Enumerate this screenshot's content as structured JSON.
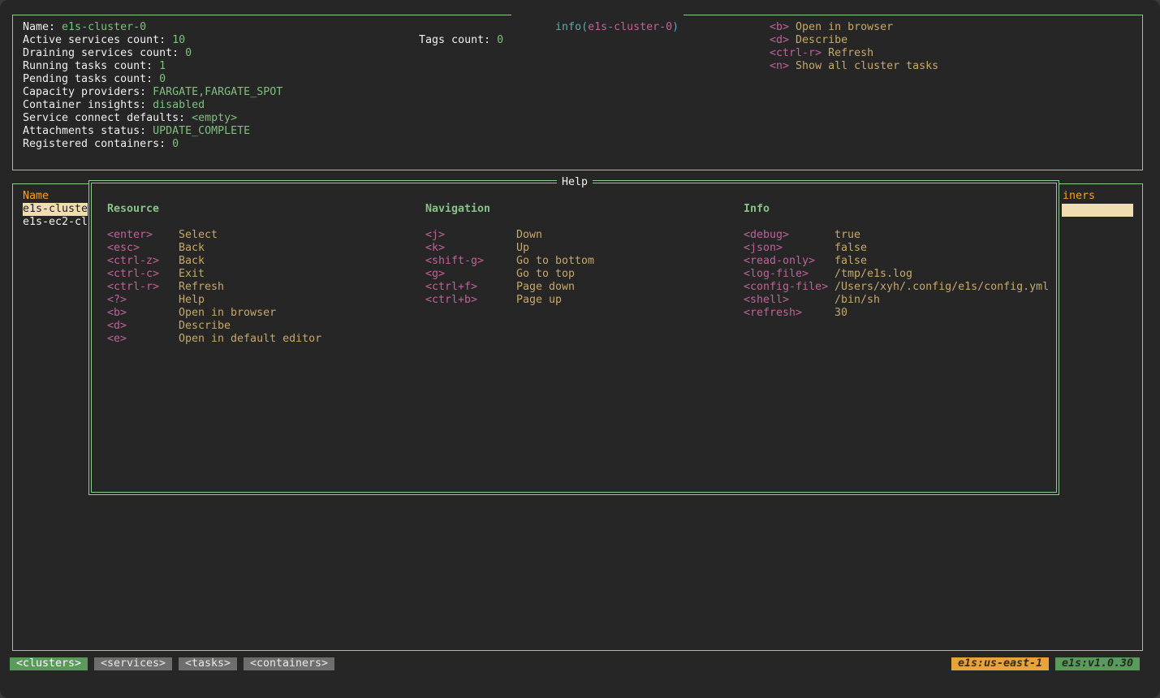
{
  "info_panel": {
    "title_prefix": "info(",
    "title_name": "e1s-cluster-0",
    "title_suffix": ")",
    "fields": [
      {
        "label": "Name: ",
        "value": "e1s-cluster-0"
      },
      {
        "label": "Active services count: ",
        "value": "10"
      },
      {
        "label": "Draining services count: ",
        "value": "0"
      },
      {
        "label": "Running tasks count: ",
        "value": "1"
      },
      {
        "label": "Pending tasks count: ",
        "value": "0"
      },
      {
        "label": "Capacity providers: ",
        "value": "FARGATE,FARGATE_SPOT"
      },
      {
        "label": "Container insights: ",
        "value": "disabled"
      },
      {
        "label": "Service connect defaults: ",
        "value": "<empty>"
      },
      {
        "label": "Attachments status: ",
        "value": "UPDATE_COMPLETE"
      },
      {
        "label": "Registered containers: ",
        "value": "0"
      }
    ],
    "tags": {
      "label": "Tags count: ",
      "value": "0"
    },
    "shortcuts": [
      {
        "key": "<b>",
        "desc": "Open in browser"
      },
      {
        "key": "<d>",
        "desc": "Describe"
      },
      {
        "key": "<ctrl-r>",
        "desc": "Refresh"
      },
      {
        "key": "<n>",
        "desc": "Show all cluster tasks"
      }
    ]
  },
  "list_panel": {
    "header_name": "Name",
    "header_right": "iners",
    "rows": [
      "e1s-cluste",
      "e1s-ec2-cl"
    ]
  },
  "help_modal": {
    "title": "Help",
    "sections": [
      {
        "title": "Resource",
        "items": [
          {
            "key": "<enter>",
            "desc": "Select"
          },
          {
            "key": "<esc>",
            "desc": "Back"
          },
          {
            "key": "<ctrl-z>",
            "desc": "Back"
          },
          {
            "key": "<ctrl-c>",
            "desc": "Exit"
          },
          {
            "key": "<ctrl-r>",
            "desc": "Refresh"
          },
          {
            "key": "<?>",
            "desc": "Help"
          },
          {
            "key": "<b>",
            "desc": "Open in browser"
          },
          {
            "key": "<d>",
            "desc": "Describe"
          },
          {
            "key": "<e>",
            "desc": "Open in default editor"
          }
        ]
      },
      {
        "title": "Navigation",
        "items": [
          {
            "key": "<j>",
            "desc": "Down"
          },
          {
            "key": "<k>",
            "desc": "Up"
          },
          {
            "key": "<shift-g>",
            "desc": "Go to bottom"
          },
          {
            "key": "<g>",
            "desc": "Go to top"
          },
          {
            "key": "<ctrl+f>",
            "desc": "Page down"
          },
          {
            "key": "<ctrl+b>",
            "desc": "Page up"
          }
        ]
      },
      {
        "title": "Info",
        "items": [
          {
            "key": "<debug>",
            "desc": "true"
          },
          {
            "key": "<json>",
            "desc": "false"
          },
          {
            "key": "<read-only>",
            "desc": "false"
          },
          {
            "key": "<log-file>",
            "desc": "/tmp/e1s.log"
          },
          {
            "key": "<config-file>",
            "desc": "/Users/xyh/.config/e1s/config.yml"
          },
          {
            "key": "<shell>",
            "desc": "/bin/sh"
          },
          {
            "key": "<refresh>",
            "desc": "30"
          }
        ]
      }
    ]
  },
  "tabs": [
    {
      "label": "<clusters>",
      "active": true
    },
    {
      "label": "<services>",
      "active": false
    },
    {
      "label": "<tasks>",
      "active": false
    },
    {
      "label": "<containers>",
      "active": false
    }
  ],
  "status": {
    "region": "e1s:us-east-1",
    "version": "e1s:v1.0.30"
  },
  "colors": {
    "border": "#8fcb8f",
    "key": "#c0629a",
    "desc": "#c8a86a",
    "value": "#7fbf7f",
    "header": "#ff9f1c",
    "selected_row": "#f0deb0",
    "region_badge": "#e8a33a",
    "version_badge": "#5a9a5a"
  }
}
